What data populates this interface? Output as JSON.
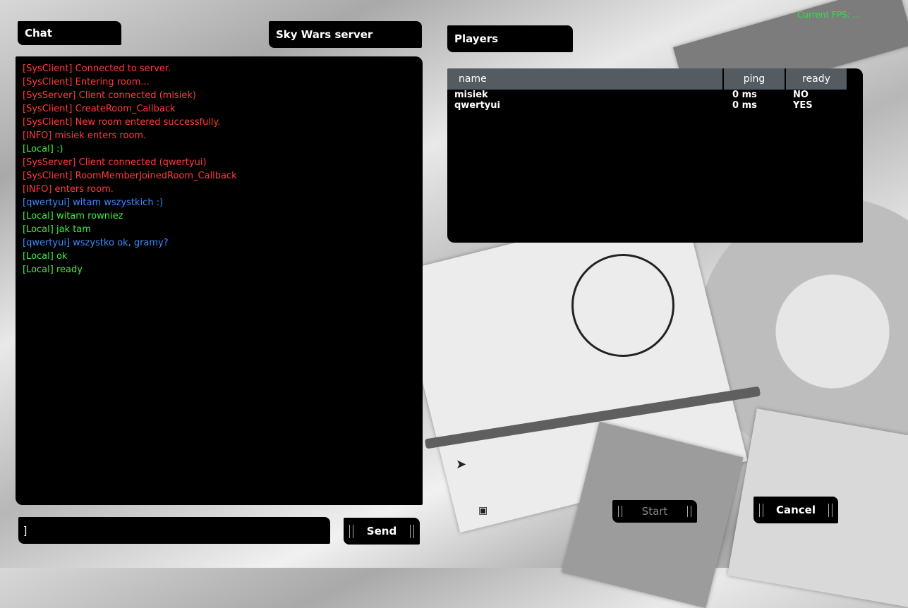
{
  "header": {
    "chat_label": "Chat",
    "server_name": "Sky Wars server",
    "players_label": "Players"
  },
  "chat": {
    "messages": [
      {
        "text": "[SysClient] Connected to server.",
        "color": "#ff3b3b"
      },
      {
        "text": "[SysClient] Entering room...",
        "color": "#ff3b3b"
      },
      {
        "text": "[SysServer] Client connected (misiek)",
        "color": "#ff3b3b"
      },
      {
        "text": "[SysClient] CreateRoom_Callback",
        "color": "#ff3b3b"
      },
      {
        "text": "[SysClient] New room entered successfully.",
        "color": "#ff3b3b"
      },
      {
        "text": "[INFO] misiek enters room.",
        "color": "#ff3b3b"
      },
      {
        "text": "[Local] :)",
        "color": "#3bef3b"
      },
      {
        "text": "[SysServer] Client connected (qwertyui)",
        "color": "#ff3b3b"
      },
      {
        "text": "[SysClient] RoomMemberJoinedRoom_Callback",
        "color": "#ff3b3b"
      },
      {
        "text": "[INFO]  enters room.",
        "color": "#ff3b3b"
      },
      {
        "text": "[qwertyui] witam wszystkich :)",
        "color": "#3b8cff"
      },
      {
        "text": "[Local] witam rowniez",
        "color": "#3bef3b"
      },
      {
        "text": "[Local] jak tam",
        "color": "#3bef3b"
      },
      {
        "text": "[qwertyui] wszystko ok, gramy?",
        "color": "#3b8cff"
      },
      {
        "text": "[Local] ok",
        "color": "#3bef3b"
      },
      {
        "text": "[Local] ready",
        "color": "#3bef3b"
      }
    ],
    "input_value": "]",
    "send_label": "Send"
  },
  "players": {
    "columns": {
      "name": "name",
      "ping": "ping",
      "ready": "ready"
    },
    "rows": [
      {
        "name": "misiek",
        "ping": "0 ms",
        "ready": "NO"
      },
      {
        "name": "qwertyui",
        "ping": "0 ms",
        "ready": "YES"
      }
    ]
  },
  "actions": {
    "start_label": "Start",
    "cancel_label": "Cancel"
  },
  "overlay": {
    "fps_title": "Current FPS: ..."
  },
  "icons": {
    "mouse_pointer": "mouse-pointer-icon",
    "small_cursor": "small-cursor-icon"
  }
}
